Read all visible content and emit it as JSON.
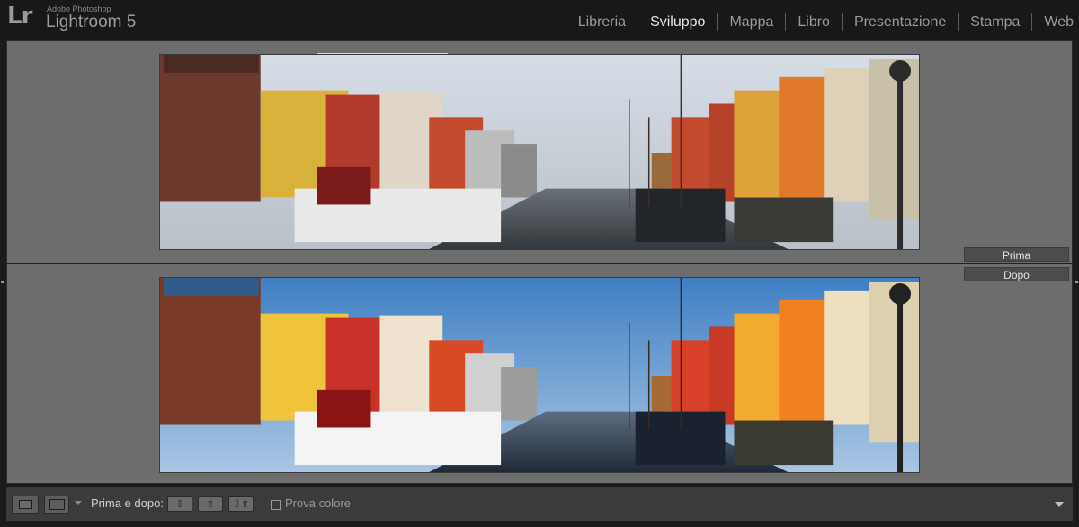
{
  "app": {
    "logo_text": "Lr",
    "vendor": "Adobe Photoshop",
    "product": "Lightroom 5"
  },
  "modules": [
    {
      "label": "Libreria",
      "active": false
    },
    {
      "label": "Sviluppo",
      "active": true
    },
    {
      "label": "Mappa",
      "active": false
    },
    {
      "label": "Libro",
      "active": false
    },
    {
      "label": "Presentazione",
      "active": false
    },
    {
      "label": "Stampa",
      "active": false
    },
    {
      "label": "Web",
      "active": false
    }
  ],
  "compare": {
    "before_label": "Prima",
    "after_label": "Dopo"
  },
  "toolbar": {
    "before_after_label": "Prima e dopo:",
    "proof_label": "Prova colore",
    "proof_checked": false
  },
  "colors": {
    "accent_active": "#e6e6e6",
    "panel_bg": "#6f6f6f"
  }
}
